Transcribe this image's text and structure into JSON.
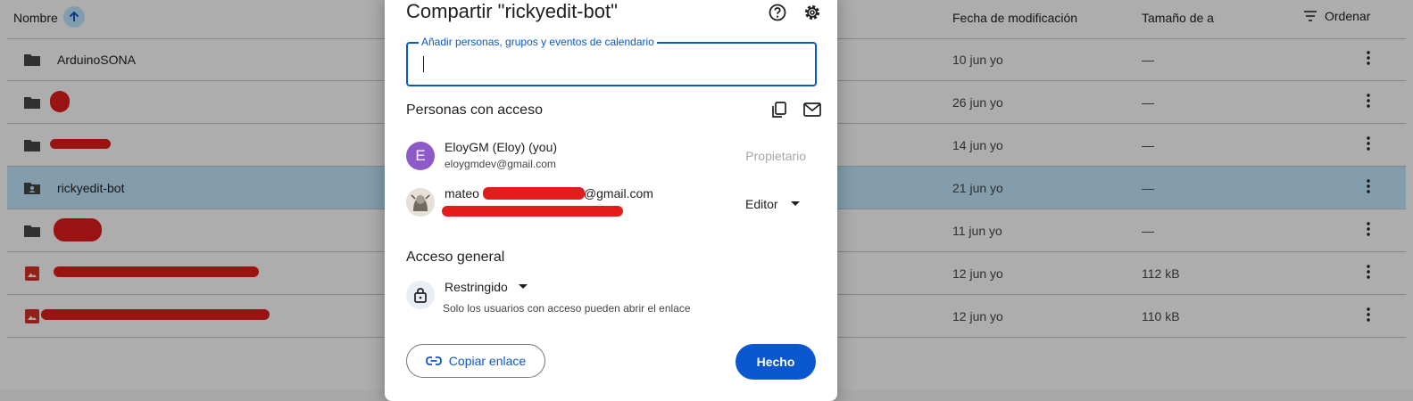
{
  "file_list": {
    "header": {
      "name": "Nombre",
      "modified": "Fecha de modificación",
      "size": "Tamaño de archivo",
      "sort": "Ordenar"
    },
    "rows": [
      {
        "name": "ArduinoSONA",
        "date": "10 jun yo",
        "size": "—",
        "type": "folder"
      },
      {
        "name": "",
        "date": "26 jun yo",
        "size": "—",
        "type": "folder"
      },
      {
        "name": "",
        "date": "14 jun yo",
        "size": "—",
        "type": "folder"
      },
      {
        "name": "rickyedit-bot",
        "date": "21 jun yo",
        "size": "—",
        "type": "shared-folder"
      },
      {
        "name": "",
        "date": "11 jun yo",
        "size": "—",
        "type": "folder"
      },
      {
        "name": "",
        "date": "12 jun yo",
        "size": "112 kB",
        "type": "image"
      },
      {
        "name": "",
        "date": "12 jun yo",
        "size": "110 kB",
        "type": "image"
      }
    ]
  },
  "dialog": {
    "title": "Compartir \"rickyedit-bot\"",
    "input_label": "Añadir personas, grupos y eventos de calendario",
    "input_value": "",
    "people_section": "Personas con acceso",
    "people": [
      {
        "initial": "E",
        "name": "EloyGM (Eloy) (you)",
        "email": "eloygmdev@gmail.com",
        "role": "Propietario"
      },
      {
        "name_prefix": "mateo",
        "name_suffix": "@gmail.com",
        "role": "Editor"
      }
    ],
    "general_section": "Acceso general",
    "access_level": "Restringido",
    "access_description": "Solo los usuarios con acceso pueden abrir el enlace",
    "copy_link": "Copiar enlace",
    "done": "Hecho"
  },
  "colors": {
    "accent": "#0b57d0",
    "selected_row": "#c2e7ff",
    "avatar": "#8e59c9",
    "redaction": "#e31c1c"
  }
}
